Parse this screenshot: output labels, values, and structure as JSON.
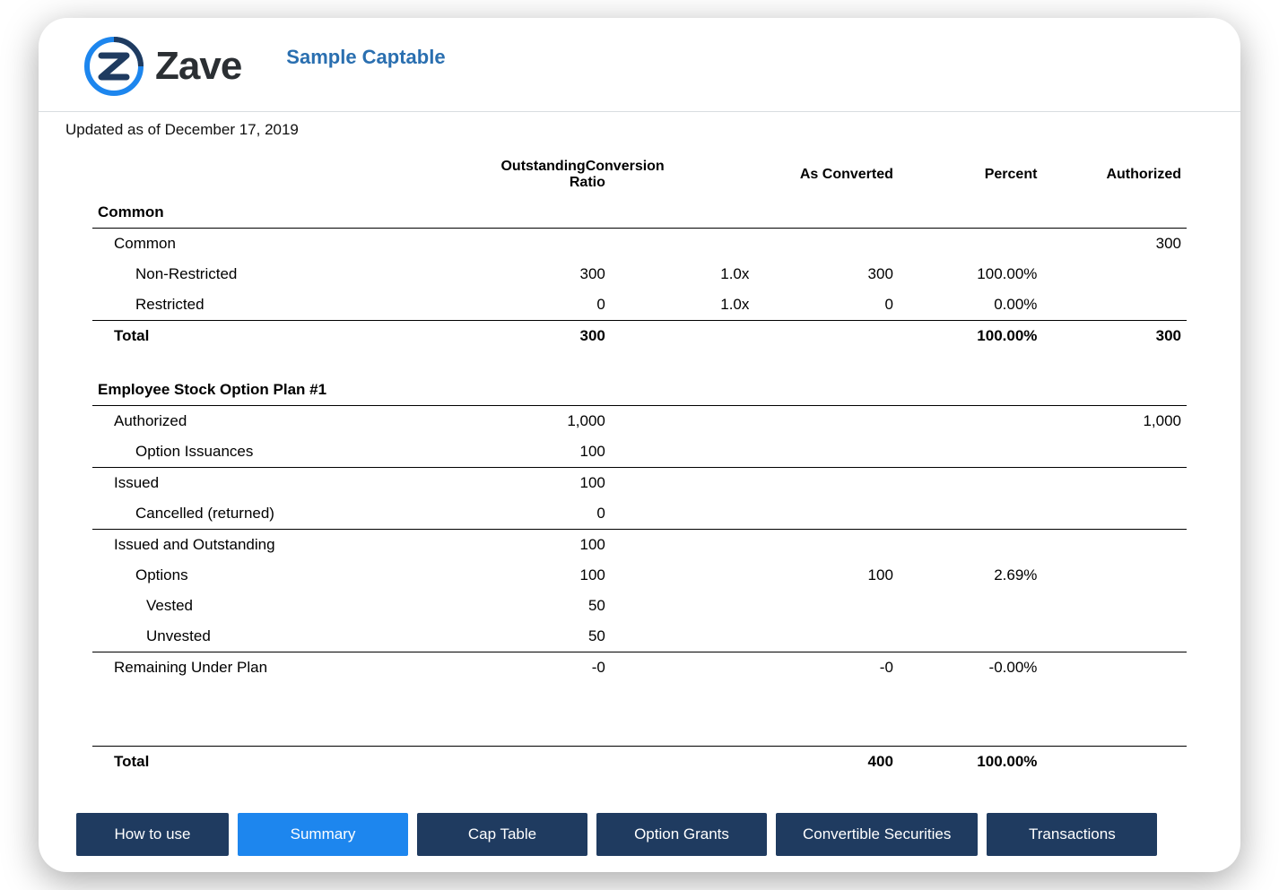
{
  "header": {
    "brand": "Zave",
    "title": "Sample Captable"
  },
  "updated_text": "Updated as of December 17, 2019",
  "columns": {
    "outstanding": "Outstanding",
    "conversion_ratio": "Conversion Ratio",
    "as_converted": "As Converted",
    "percent": "Percent",
    "authorized": "Authorized"
  },
  "sections": {
    "common": {
      "heading": "Common",
      "rows": {
        "common": {
          "label": "Common",
          "authorized": "300"
        },
        "non_restricted": {
          "label": "Non-Restricted",
          "outstanding": "300",
          "ratio": "1.0x",
          "as_converted": "300",
          "percent": "100.00%"
        },
        "restricted": {
          "label": "Restricted",
          "outstanding": "0",
          "ratio": "1.0x",
          "as_converted": "0",
          "percent": "0.00%"
        },
        "total": {
          "label": "Total",
          "outstanding": "300",
          "percent": "100.00%",
          "authorized": "300"
        }
      }
    },
    "esop": {
      "heading": "Employee Stock Option Plan #1",
      "rows": {
        "authorized": {
          "label": "Authorized",
          "outstanding": "1,000",
          "authorized": "1,000"
        },
        "option_issuances": {
          "label": "Option Issuances",
          "outstanding": "100"
        },
        "issued": {
          "label": "Issued",
          "outstanding": "100"
        },
        "cancelled": {
          "label": "Cancelled (returned)",
          "outstanding": "0"
        },
        "issued_out": {
          "label": "Issued and Outstanding",
          "outstanding": "100"
        },
        "options": {
          "label": "Options",
          "outstanding": "100",
          "as_converted": "100",
          "percent": "2.69%"
        },
        "vested": {
          "label": "Vested",
          "outstanding": "50"
        },
        "unvested": {
          "label": "Unvested",
          "outstanding": "50"
        },
        "remaining": {
          "label": "Remaining Under Plan",
          "outstanding": "-0",
          "as_converted": "-0",
          "percent": "-0.00%"
        }
      }
    },
    "grand_total": {
      "label": "Total",
      "as_converted": "400",
      "percent": "100.00%"
    }
  },
  "tabs": [
    {
      "id": "howto",
      "label": "How to use",
      "active": false
    },
    {
      "id": "summary",
      "label": "Summary",
      "active": true
    },
    {
      "id": "captable",
      "label": "Cap Table",
      "active": false
    },
    {
      "id": "grants",
      "label": "Option Grants",
      "active": false
    },
    {
      "id": "conv",
      "label": "Convertible Securities",
      "active": false
    },
    {
      "id": "tx",
      "label": "Transactions",
      "active": false
    }
  ]
}
